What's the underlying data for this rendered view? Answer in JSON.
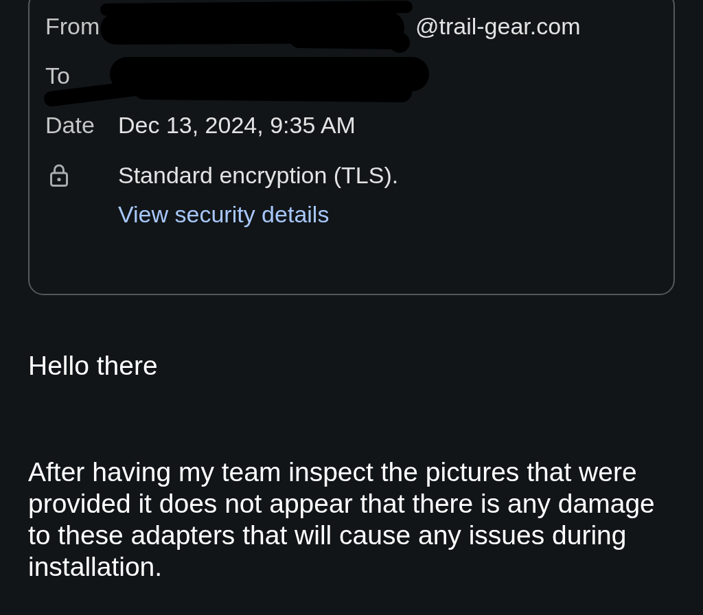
{
  "header": {
    "fields": [
      {
        "label": "From",
        "value": "@trail-gear.com",
        "redacted": true
      },
      {
        "label": "To",
        "redacted": true
      },
      {
        "label": "Date",
        "value": "Dec 13, 2024, 9:35 AM",
        "redacted": false
      }
    ],
    "encryption": {
      "text": "Standard encryption (TLS).",
      "link": "View security details"
    }
  },
  "body": {
    "greeting": "Hello there",
    "paragraphs": [
      "After having my team inspect the pictures that were provided it does not appear that there is any damage to these adapters that will cause any issues during installation."
    ]
  }
}
